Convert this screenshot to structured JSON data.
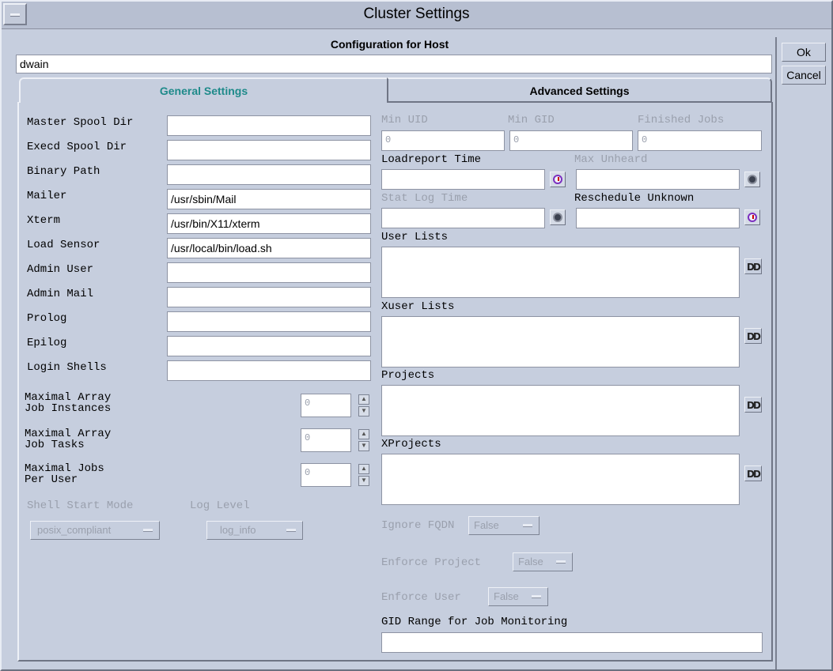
{
  "window": {
    "title": "Cluster Settings"
  },
  "header": {
    "config_label": "Configuration for Host",
    "host_value": "dwain"
  },
  "buttons": {
    "ok": "Ok",
    "cancel": "Cancel"
  },
  "tabs": [
    {
      "label": "General Settings",
      "active": true
    },
    {
      "label": "Advanced Settings",
      "active": false
    }
  ],
  "left": {
    "fields": [
      {
        "label": "Master Spool Dir",
        "value": ""
      },
      {
        "label": "Execd Spool Dir",
        "value": ""
      },
      {
        "label": "Binary Path",
        "value": ""
      },
      {
        "label": "Mailer",
        "value": "/usr/sbin/Mail"
      },
      {
        "label": "Xterm",
        "value": "/usr/bin/X11/xterm"
      },
      {
        "label": "Load Sensor",
        "value": "/usr/local/bin/load.sh"
      },
      {
        "label": "Admin User",
        "value": ""
      },
      {
        "label": "Admin Mail",
        "value": ""
      },
      {
        "label": "Prolog",
        "value": ""
      },
      {
        "label": "Epilog",
        "value": ""
      },
      {
        "label": "Login Shells",
        "value": ""
      }
    ],
    "spinners": [
      {
        "label1": "Maximal Array",
        "label2": "Job Instances",
        "value": "0"
      },
      {
        "label1": "Maximal Array",
        "label2": "Job Tasks",
        "value": "0"
      },
      {
        "label1": "Maximal Jobs",
        "label2": "Per User",
        "value": "0"
      }
    ],
    "shell_start_mode": {
      "label": "Shell Start Mode",
      "value": "posix_compliant"
    },
    "log_level": {
      "label": "Log Level",
      "value": "log_info"
    }
  },
  "right": {
    "min_uid": {
      "label": "Min UID",
      "value": "0"
    },
    "min_gid": {
      "label": "Min GID",
      "value": "0"
    },
    "finished_jobs": {
      "label": "Finished Jobs",
      "value": "0"
    },
    "loadreport_time": {
      "label": "Loadreport Time",
      "value": ""
    },
    "max_unheard": {
      "label": "Max Unheard",
      "value": ""
    },
    "stat_log_time": {
      "label": "Stat Log Time",
      "value": ""
    },
    "reschedule_unknown": {
      "label": "Reschedule Unknown",
      "value": ""
    },
    "lists": [
      {
        "label": "User Lists"
      },
      {
        "label": "Xuser Lists"
      },
      {
        "label": "Projects"
      },
      {
        "label": "XProjects"
      }
    ],
    "ignore_fqdn": {
      "label": "Ignore FQDN",
      "value": "False"
    },
    "enforce_project": {
      "label": "Enforce Project",
      "value": "False"
    },
    "enforce_user": {
      "label": "Enforce User",
      "value": "False"
    },
    "gid_range": {
      "label": "GID Range for Job Monitoring",
      "value": ""
    }
  },
  "icons": {
    "clock": "clock-icon",
    "list": "list-editor-icon",
    "spin_up": "spin-up-icon",
    "spin_down": "spin-down-icon",
    "menu": "window-menu-icon"
  },
  "list_icon_glyph": "DD",
  "spin_up_glyph": "▲",
  "spin_down_glyph": "▼"
}
